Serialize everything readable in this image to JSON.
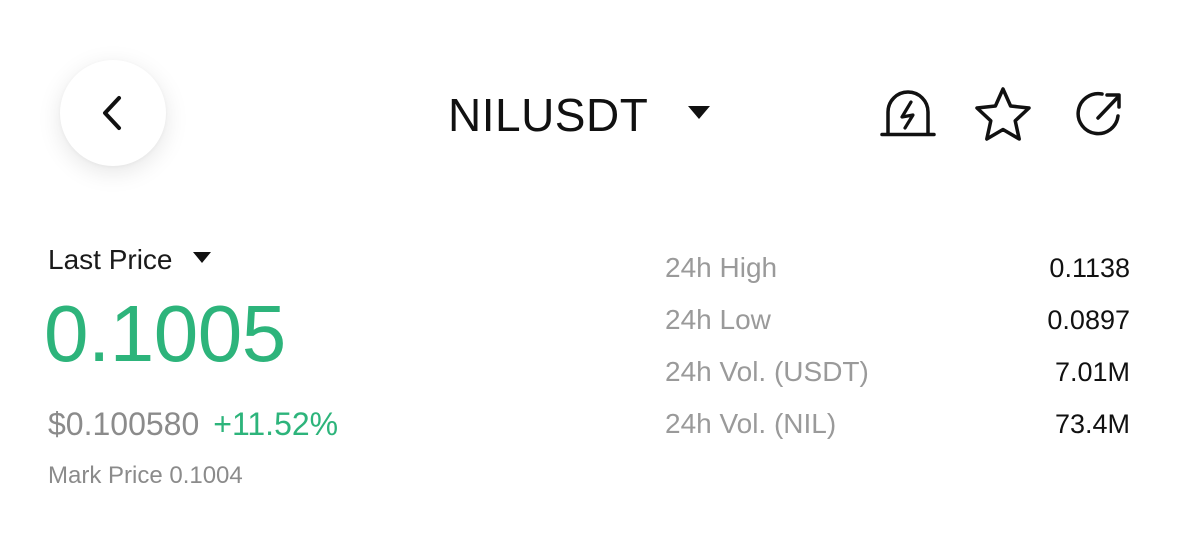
{
  "header": {
    "back_icon": "chevron-left-icon",
    "symbol": "NILUSDT",
    "symbol_dropdown_icon": "caret-down-icon",
    "actions": [
      {
        "name": "price-alert",
        "icon": "bell-lightning-icon"
      },
      {
        "name": "favorite",
        "icon": "star-icon"
      },
      {
        "name": "share",
        "icon": "share-arrow-icon"
      }
    ]
  },
  "price": {
    "label": "Last Price",
    "value": "0.1005",
    "fiat_value": "$0.100580",
    "change_percent": "+11.52%",
    "mark_price": "Mark Price 0.1004"
  },
  "stats": [
    {
      "label": "24h High",
      "value": "0.1138"
    },
    {
      "label": "24h Low",
      "value": "0.0897"
    },
    {
      "label": "24h Vol. (USDT)",
      "value": "7.01M"
    },
    {
      "label": "24h Vol. (NIL)",
      "value": "73.4M"
    }
  ],
  "colors": {
    "positive": "#2db47b",
    "muted": "#8b8b8b",
    "text": "#111111"
  }
}
